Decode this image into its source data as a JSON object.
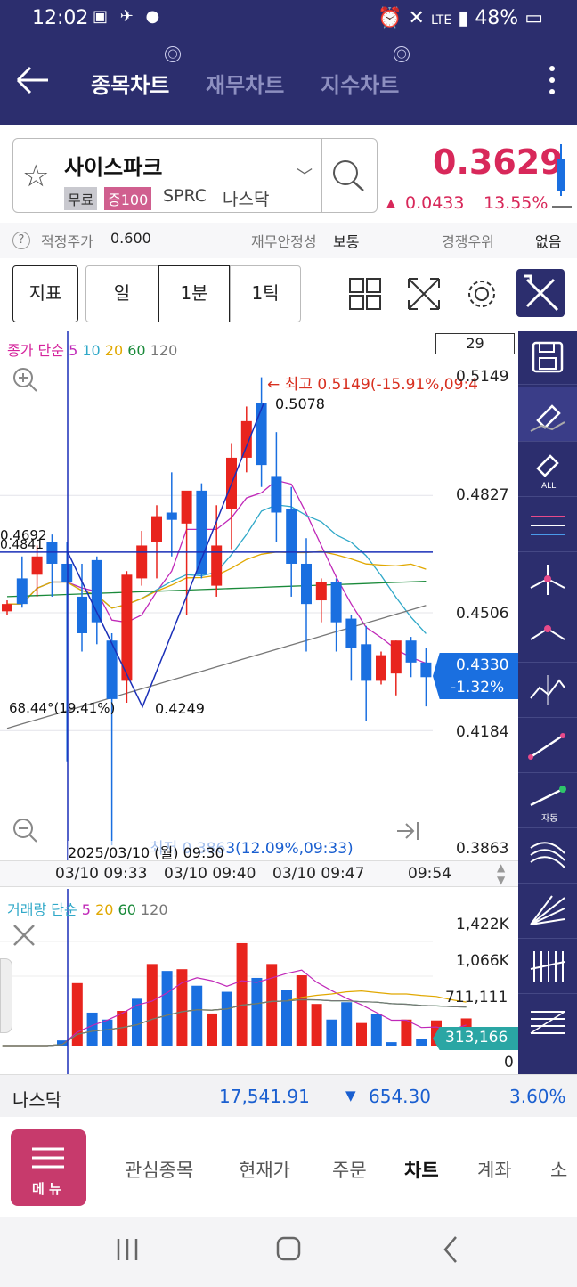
{
  "status": {
    "time": "12:02",
    "battery": "48%",
    "network": "LTE"
  },
  "header": {
    "tabs": [
      {
        "label": "종목차트",
        "active": true
      },
      {
        "label": "재무차트",
        "active": false
      },
      {
        "label": "지수차트",
        "active": false
      }
    ]
  },
  "stock": {
    "name": "사이스파크",
    "tag_free": "무료",
    "tag_margin": "증100",
    "ticker": "SPRC",
    "market": "나스닥",
    "price": "0.3629",
    "change": "0.0433",
    "change_pct": "13.55%"
  },
  "info": {
    "fair_label": "적정주가",
    "fair_value": "0.600",
    "stability_label": "재무안정성",
    "stability_value": "보통",
    "competition_label": "경쟁우위",
    "competition_value": "없음"
  },
  "toolbar": {
    "indicator": "지표",
    "day": "일",
    "min": "1분",
    "tick": "1틱"
  },
  "chart_legend": {
    "main_prefix": "종가 단순",
    "ma5": "5",
    "ma10": "10",
    "ma20": "20",
    "ma60": "60",
    "ma120": "120",
    "vol_prefix": "거래량 단순",
    "vma5": "5",
    "vma20": "20",
    "vma60": "60",
    "vma120": "120",
    "count_box": "29"
  },
  "chart_text": {
    "high_label": "← 최고 0.5149(-15.91%,09:4",
    "high_price_partial": "0.5149",
    "low_label": "최저 0.3863(12.09%,09:33)",
    "pt_high": "0.5078",
    "pt_low": "0.4249",
    "angle": "68.44°(19.41%)",
    "left_price_a": "0.4692",
    "left_price_b": "0.4841",
    "crosshair_date": "2025/03/10 (월) 09:30",
    "current_price": "0.4330",
    "current_pct": "-1.32%",
    "x_ticks": [
      "03/10 09:33",
      "03/10 09:40",
      "03/10 09:47",
      "09:54"
    ],
    "vol_current": "313,166"
  },
  "chart_data": [
    {
      "type": "candlestick",
      "title": "",
      "y_ticks": [
        "0.5149",
        "0.4827",
        "0.4506",
        "0.4330",
        "0.4184",
        "0.3863"
      ],
      "ylim": [
        0.3863,
        0.5149
      ],
      "candles": [
        {
          "o": 0.451,
          "h": 0.454,
          "l": 0.45,
          "c": 0.453
        },
        {
          "o": 0.46,
          "h": 0.466,
          "l": 0.452,
          "c": 0.453
        },
        {
          "o": 0.461,
          "h": 0.469,
          "l": 0.455,
          "c": 0.466
        },
        {
          "o": 0.47,
          "h": 0.472,
          "l": 0.455,
          "c": 0.464
        },
        {
          "o": 0.464,
          "h": 0.47,
          "l": 0.41,
          "c": 0.459
        },
        {
          "o": 0.455,
          "h": 0.464,
          "l": 0.44,
          "c": 0.445
        },
        {
          "o": 0.465,
          "h": 0.466,
          "l": 0.442,
          "c": 0.448
        },
        {
          "o": 0.443,
          "h": 0.445,
          "l": 0.387,
          "c": 0.427
        },
        {
          "o": 0.432,
          "h": 0.462,
          "l": 0.426,
          "c": 0.461
        },
        {
          "o": 0.46,
          "h": 0.473,
          "l": 0.458,
          "c": 0.469
        },
        {
          "o": 0.47,
          "h": 0.48,
          "l": 0.46,
          "c": 0.477
        },
        {
          "o": 0.478,
          "h": 0.489,
          "l": 0.466,
          "c": 0.476
        },
        {
          "o": 0.475,
          "h": 0.482,
          "l": 0.45,
          "c": 0.484
        },
        {
          "o": 0.484,
          "h": 0.486,
          "l": 0.46,
          "c": 0.461
        },
        {
          "o": 0.458,
          "h": 0.48,
          "l": 0.455,
          "c": 0.469
        },
        {
          "o": 0.479,
          "h": 0.497,
          "l": 0.468,
          "c": 0.493
        },
        {
          "o": 0.493,
          "h": 0.507,
          "l": 0.489,
          "c": 0.503
        },
        {
          "o": 0.508,
          "h": 0.515,
          "l": 0.485,
          "c": 0.491
        },
        {
          "o": 0.488,
          "h": 0.5,
          "l": 0.47,
          "c": 0.478
        },
        {
          "o": 0.479,
          "h": 0.485,
          "l": 0.455,
          "c": 0.464
        },
        {
          "o": 0.464,
          "h": 0.471,
          "l": 0.44,
          "c": 0.453
        },
        {
          "o": 0.454,
          "h": 0.46,
          "l": 0.448,
          "c": 0.459
        },
        {
          "o": 0.459,
          "h": 0.46,
          "l": 0.44,
          "c": 0.448
        },
        {
          "o": 0.449,
          "h": 0.45,
          "l": 0.432,
          "c": 0.441
        },
        {
          "o": 0.442,
          "h": 0.447,
          "l": 0.421,
          "c": 0.432
        },
        {
          "o": 0.432,
          "h": 0.44,
          "l": 0.431,
          "c": 0.439
        },
        {
          "o": 0.434,
          "h": 0.443,
          "l": 0.428,
          "c": 0.443
        },
        {
          "o": 0.443,
          "h": 0.444,
          "l": 0.433,
          "c": 0.437
        },
        {
          "o": 0.437,
          "h": 0.441,
          "l": 0.425,
          "c": 0.433
        }
      ]
    },
    {
      "type": "bar",
      "title": "",
      "y_ticks": [
        "1,422K",
        "1,066K",
        "711,111",
        "0"
      ],
      "ylim": [
        0,
        1600000
      ],
      "values": [
        0,
        0,
        0,
        0,
        0,
        60000,
        720000,
        380000,
        300000,
        400000,
        540000,
        940000,
        860000,
        880000,
        690000,
        370000,
        620000,
        1180000,
        780000,
        940000,
        640000,
        810000,
        480000,
        300000,
        500000,
        260000,
        360000,
        40000,
        300000,
        80000,
        290000,
        200000,
        313166
      ],
      "colors_up": "#e8241d",
      "colors_down": "#1a6fe0"
    }
  ],
  "ticker": {
    "name": "나스닥",
    "value": "17,541.91",
    "change": "654.30",
    "pct": "3.60%"
  },
  "nav": {
    "menu": "메 뉴",
    "items": [
      "관심종목",
      "현재가",
      "주문",
      "차트",
      "계좌",
      "소"
    ]
  },
  "colors": {
    "header": "#2c2e6e",
    "up": "#e8241d",
    "down": "#1a6fe0",
    "accent": "#d8285a"
  }
}
